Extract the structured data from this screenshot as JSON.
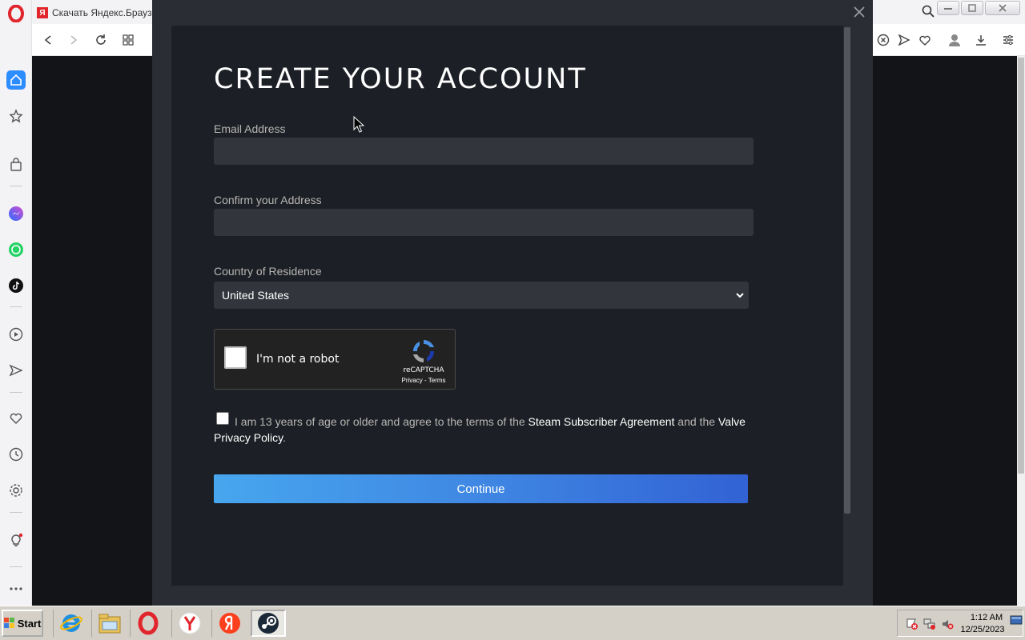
{
  "browser": {
    "tab_title": "Скачать Яндекс.Браузер",
    "tab_favicon_letter": "Я",
    "sidebar_icons": [
      "home-icon",
      "star-icon",
      "shopping-bag-icon",
      "messenger-icon",
      "whatsapp-icon",
      "tiktok-icon",
      "player-icon",
      "send-icon",
      "heart-icon",
      "history-icon",
      "settings-icon",
      "lightbulb-icon",
      "more-icon"
    ],
    "toolbar_icons": [
      "back-icon",
      "forward-icon",
      "reload-icon",
      "tabs-grid-icon",
      "adblock-icon",
      "send-icon",
      "heart-icon",
      "account-icon",
      "download-icon",
      "easy-setup-icon"
    ]
  },
  "modal": {
    "title": "CREATE YOUR ACCOUNT",
    "email": {
      "label": "Email Address",
      "value": "",
      "placeholder": ""
    },
    "confirm": {
      "label": "Confirm your Address",
      "value": "",
      "placeholder": ""
    },
    "country": {
      "label": "Country of Residence",
      "selected": "United States"
    },
    "recaptcha": {
      "label": "I'm not a robot",
      "brand": "reCAPTCHA",
      "links": "Privacy - Terms",
      "checked": false
    },
    "agreement": {
      "text_before": "I am 13 years of age or older and agree to the terms of the ",
      "link1": "Steam Subscriber Agreement",
      "text_mid": " and the ",
      "link2": "Valve Privacy Policy",
      "text_after": ".",
      "checked": false
    },
    "continue_label": "Continue"
  },
  "taskbar": {
    "start_label": "Start",
    "apps": [
      "internet-explorer-icon",
      "file-explorer-icon",
      "opera-icon",
      "yandex-browser-icon",
      "yandex-icon",
      "steam-icon"
    ],
    "clock_time": "1:12 AM",
    "clock_date": "12/25/2023"
  },
  "colors": {
    "page_bg": "#121417",
    "modal_bg": "#2a2d33",
    "panel_bg": "#1c1f25",
    "input_bg": "#32353c",
    "button_start": "#47a6ee",
    "button_end": "#3262d4",
    "opera_red": "#e0262c"
  }
}
